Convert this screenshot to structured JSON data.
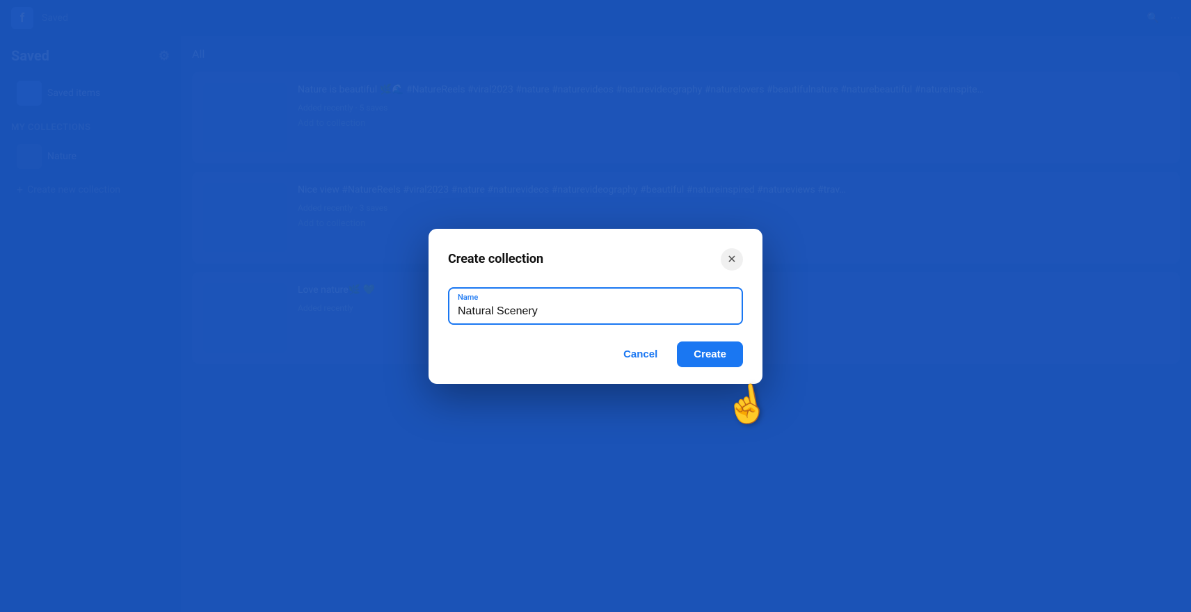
{
  "app": {
    "logo": "f",
    "logo_label": "Facebook"
  },
  "sidebar": {
    "title": "Saved",
    "gear_icon": "⚙",
    "saved_items_label": "Saved items",
    "my_collections_label": "My collections",
    "collections": [
      {
        "label": "Nature"
      }
    ],
    "create_collection_label": "Create new collection"
  },
  "feed": {
    "filter_label": "All",
    "items": [
      {
        "text": "Nature is beautiful 🌿🌊 #NatureReels #viral2023 #nature #naturevideos #naturevideography #naturelovers #beautifulnature #naturebeautiful #natureinspite…",
        "meta": "Added recently · 5 saves",
        "action": "Add to collection"
      },
      {
        "text": "Nice view #NatureReels #viral2023 #nature #naturevideos #naturevideography #beautiful #natureinspired #natureviews #trav…",
        "meta": "Added recently · 3 saves",
        "action": "Add to collection"
      },
      {
        "text": "Love nature🌿 💚",
        "meta": "Added recently",
        "action": ""
      }
    ]
  },
  "modal": {
    "title": "Create collection",
    "close_aria": "Close",
    "close_icon": "✕",
    "input_label": "Name",
    "input_value": "Natural Scenery",
    "input_placeholder": "Name",
    "cancel_label": "Cancel",
    "create_label": "Create"
  }
}
